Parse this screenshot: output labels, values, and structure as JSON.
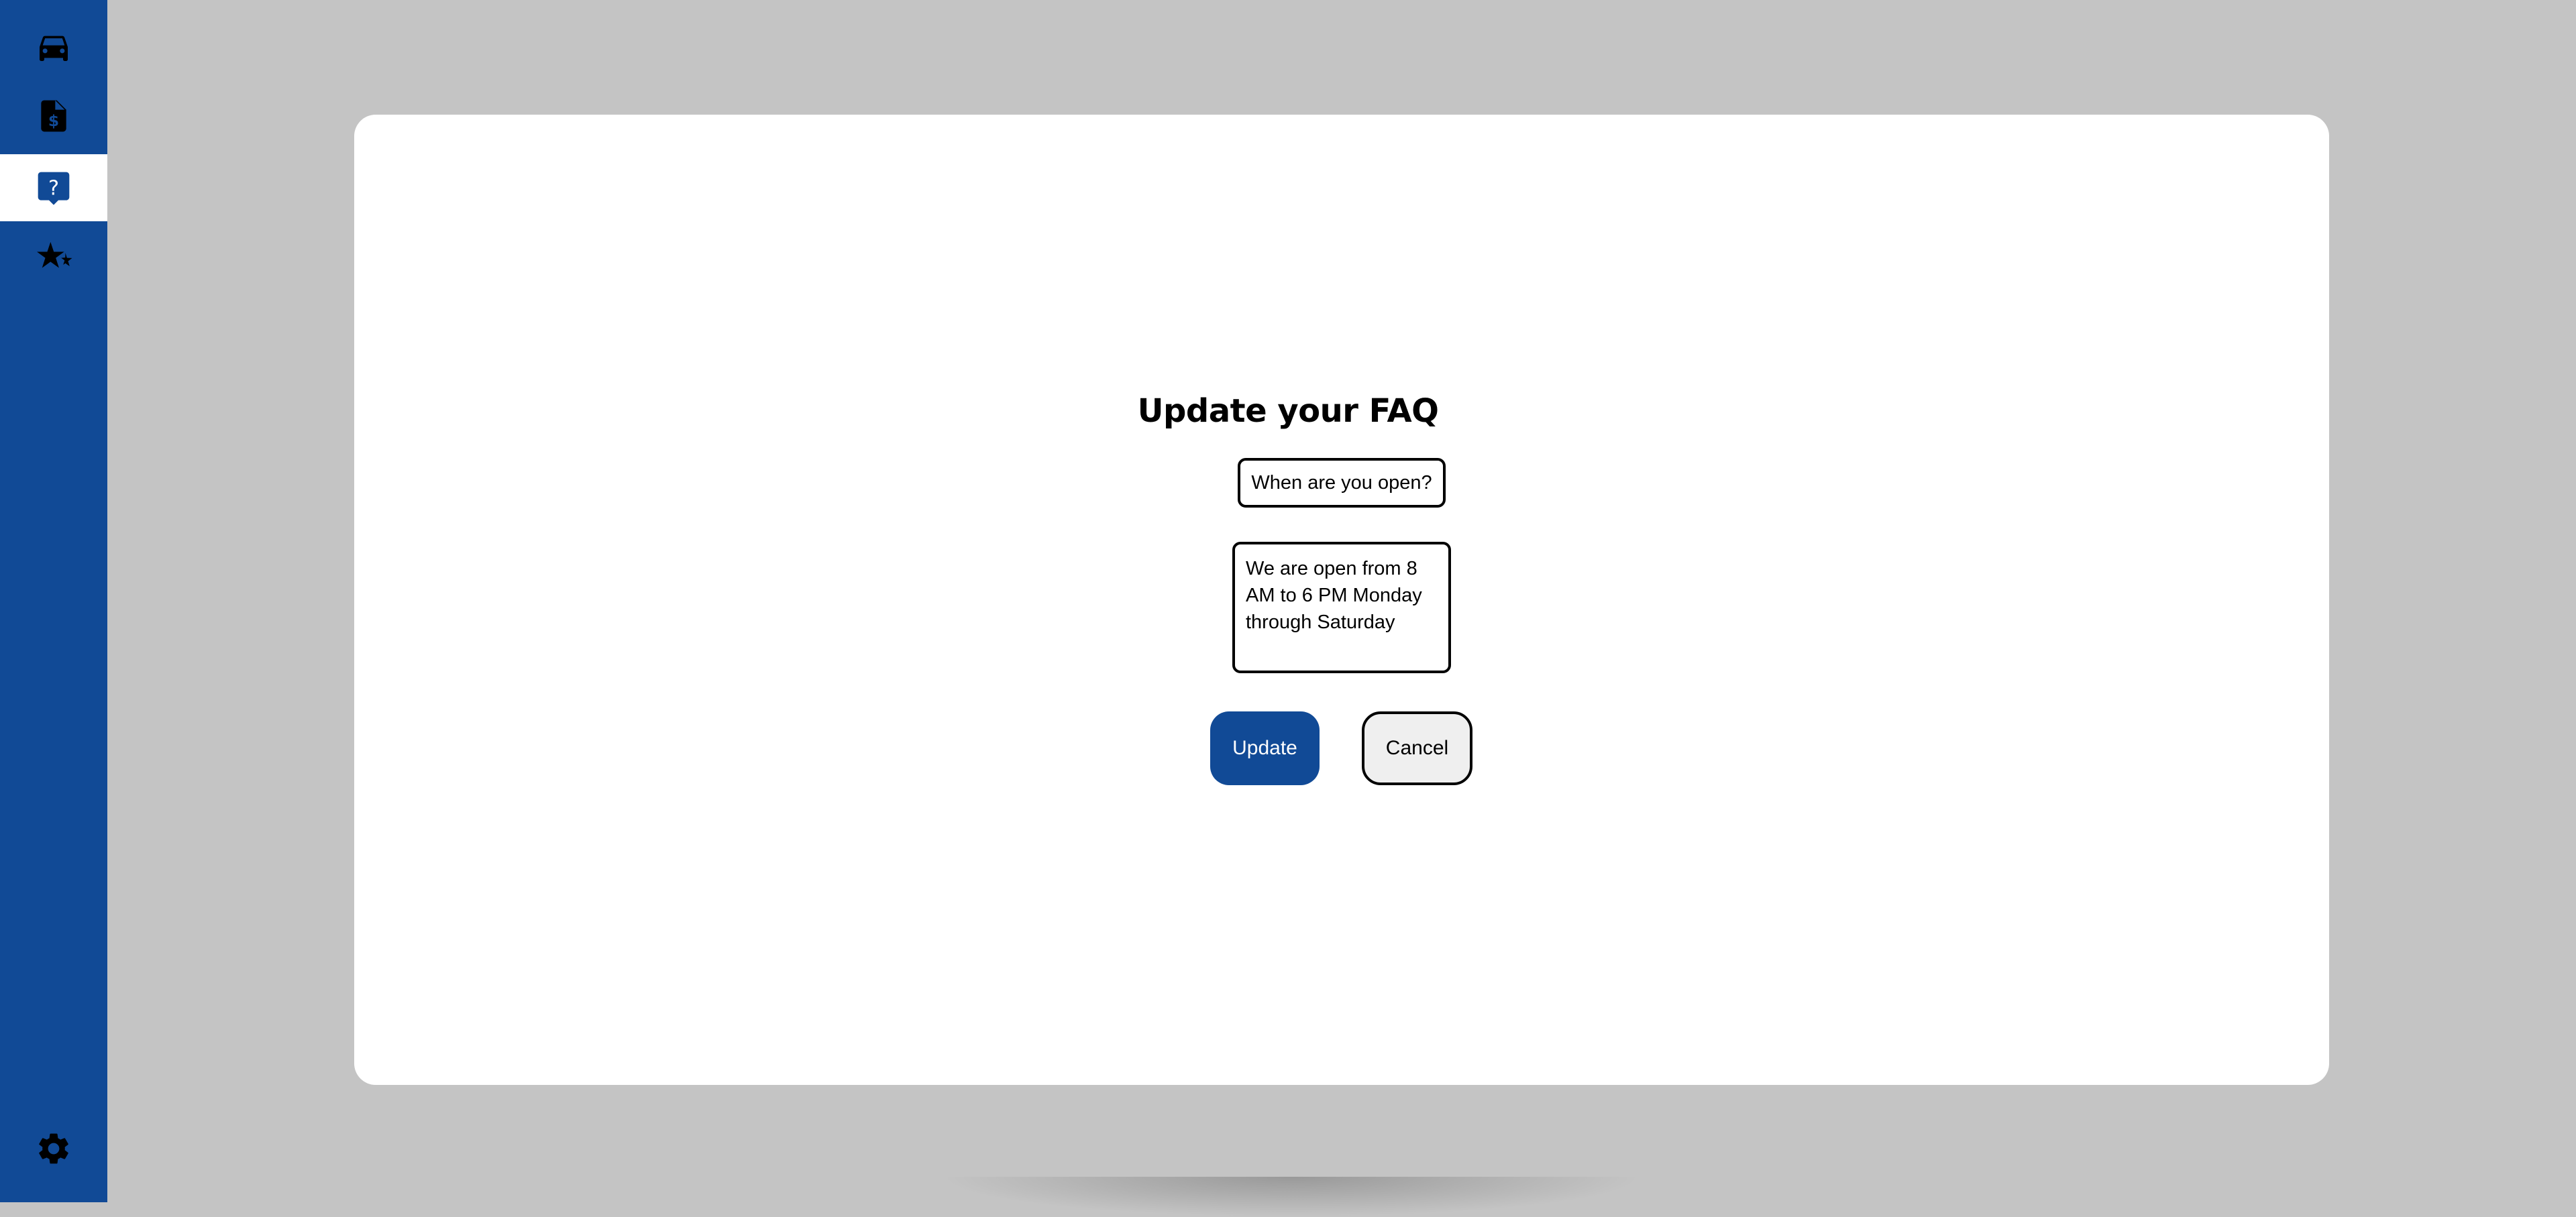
{
  "colors": {
    "sidebar": "#114a96",
    "accent": "#114a96",
    "backdrop": "#c4c4c4",
    "modal": "#ffffff",
    "cancel_bg": "#efefef"
  },
  "sidebar": {
    "items": [
      {
        "icon": "car-icon",
        "active": false
      },
      {
        "icon": "invoice-icon",
        "active": false
      },
      {
        "icon": "faq-icon",
        "active": true
      },
      {
        "icon": "star-rating-icon",
        "active": false
      }
    ],
    "settings_icon": "gear-icon"
  },
  "modal": {
    "title": "Update your FAQ",
    "question_value": "When are you open?",
    "answer_value": "We are open from 8 AM to 6 PM Monday through Saturday",
    "update_label": "Update",
    "cancel_label": "Cancel"
  }
}
